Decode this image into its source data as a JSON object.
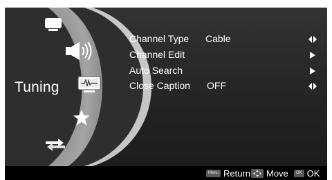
{
  "category": {
    "label": "Tuning"
  },
  "sidebar": {
    "icons": [
      {
        "name": "picture-icon"
      },
      {
        "name": "sound-icon"
      },
      {
        "name": "tuning-icon"
      },
      {
        "name": "favorite-star-icon"
      },
      {
        "name": "setup-icon"
      }
    ]
  },
  "menu": {
    "items": [
      {
        "label": "Channel Type",
        "value": "Cable",
        "arrow": "left-right"
      },
      {
        "label": "Channel Edit",
        "value": "",
        "arrow": "right"
      },
      {
        "label": "Auto Search",
        "value": "",
        "arrow": "right"
      },
      {
        "label": "Close Caption",
        "value": "OFF",
        "arrow": "left-right"
      }
    ]
  },
  "footer": {
    "return_key": "Menu",
    "return_label": "Return",
    "move_label": "Move",
    "ok_key": "OK",
    "ok_label": "OK"
  },
  "colors": {
    "background": "#2b2b2b",
    "wheel": "#9a9a9a",
    "text": "#ffffff",
    "footer": "#000000"
  }
}
